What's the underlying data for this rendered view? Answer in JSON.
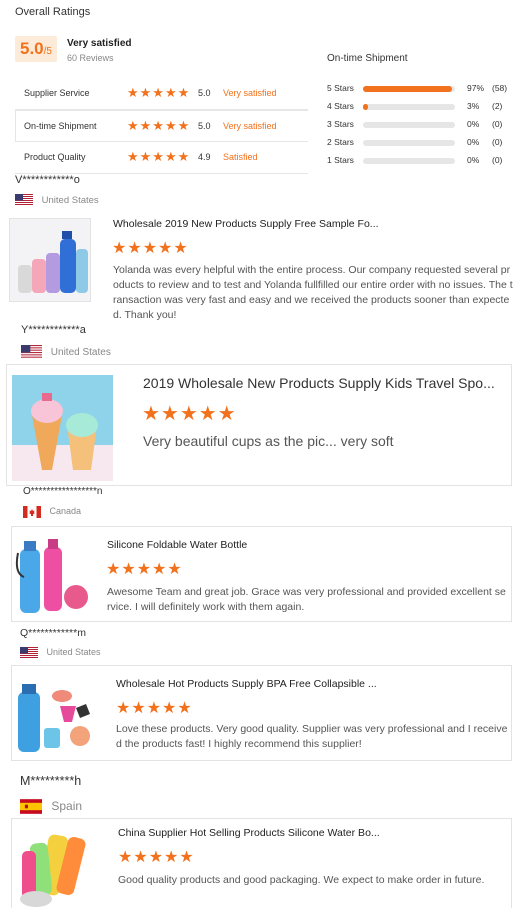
{
  "overall": {
    "heading": "Overall Ratings",
    "score": "5.0",
    "score_suffix": "/5",
    "label": "Very satisfied",
    "reviews": "60 Reviews"
  },
  "ratings": [
    {
      "name": "Supplier Service",
      "score": "5.0",
      "label": "Very satisfied"
    },
    {
      "name": "On-time Shipment",
      "score": "5.0",
      "label": "Very satisfied"
    },
    {
      "name": "Product Quality",
      "score": "4.9",
      "label": "Satisfied"
    }
  ],
  "shipment": {
    "heading": "On-time Shipment",
    "rows": [
      {
        "label": "5 Stars",
        "pct": "97%",
        "count": "(58)",
        "fraction": 0.97
      },
      {
        "label": "4 Stars",
        "pct": "3%",
        "count": "(2)",
        "fraction": 0.05
      },
      {
        "label": "3 Stars",
        "pct": "0%",
        "count": "(0)",
        "fraction": 0
      },
      {
        "label": "2 Stars",
        "pct": "0%",
        "count": "(0)",
        "fraction": 0
      },
      {
        "label": "1 Stars",
        "pct": "0%",
        "count": "(0)",
        "fraction": 0
      }
    ]
  },
  "stars_glyph": "★★★★★",
  "reviews": [
    {
      "user": "V************o",
      "country": "United States",
      "title": "Wholesale 2019 New Products Supply Free Sample Fo...",
      "text": "Yolanda was every helpful with the entire process. Our company requested several products to review and to test and Yolanda fullfilled our entire order with no issues. The transaction was very fast and easy and we received the products sooner than expected. Thank you!"
    },
    {
      "user": "Y************a",
      "country": "United States",
      "title": "2019 Wholesale New Products Supply Kids Travel Spo...",
      "text": "Very beautiful cups as the pic... very soft"
    },
    {
      "user": "O*****************n",
      "country": "Canada",
      "title": "Silicone Foldable Water Bottle",
      "text": "Awesome Team and great job. Grace was very professional and provided excellent service. I will definitely work with them again."
    },
    {
      "user": "Q************m",
      "country": "United States",
      "title": "Wholesale Hot Products Supply BPA Free Collapsible ...",
      "text": "Love these products. Very good quality. Supplier was very professional and I received the products fast! I highly recommend this supplier!"
    },
    {
      "user": "M*********h",
      "country": "Spain",
      "title": "China Supplier Hot Selling Products Silicone Water Bo...",
      "text": "Good quality products and good packaging. We expect to make order in future."
    }
  ]
}
